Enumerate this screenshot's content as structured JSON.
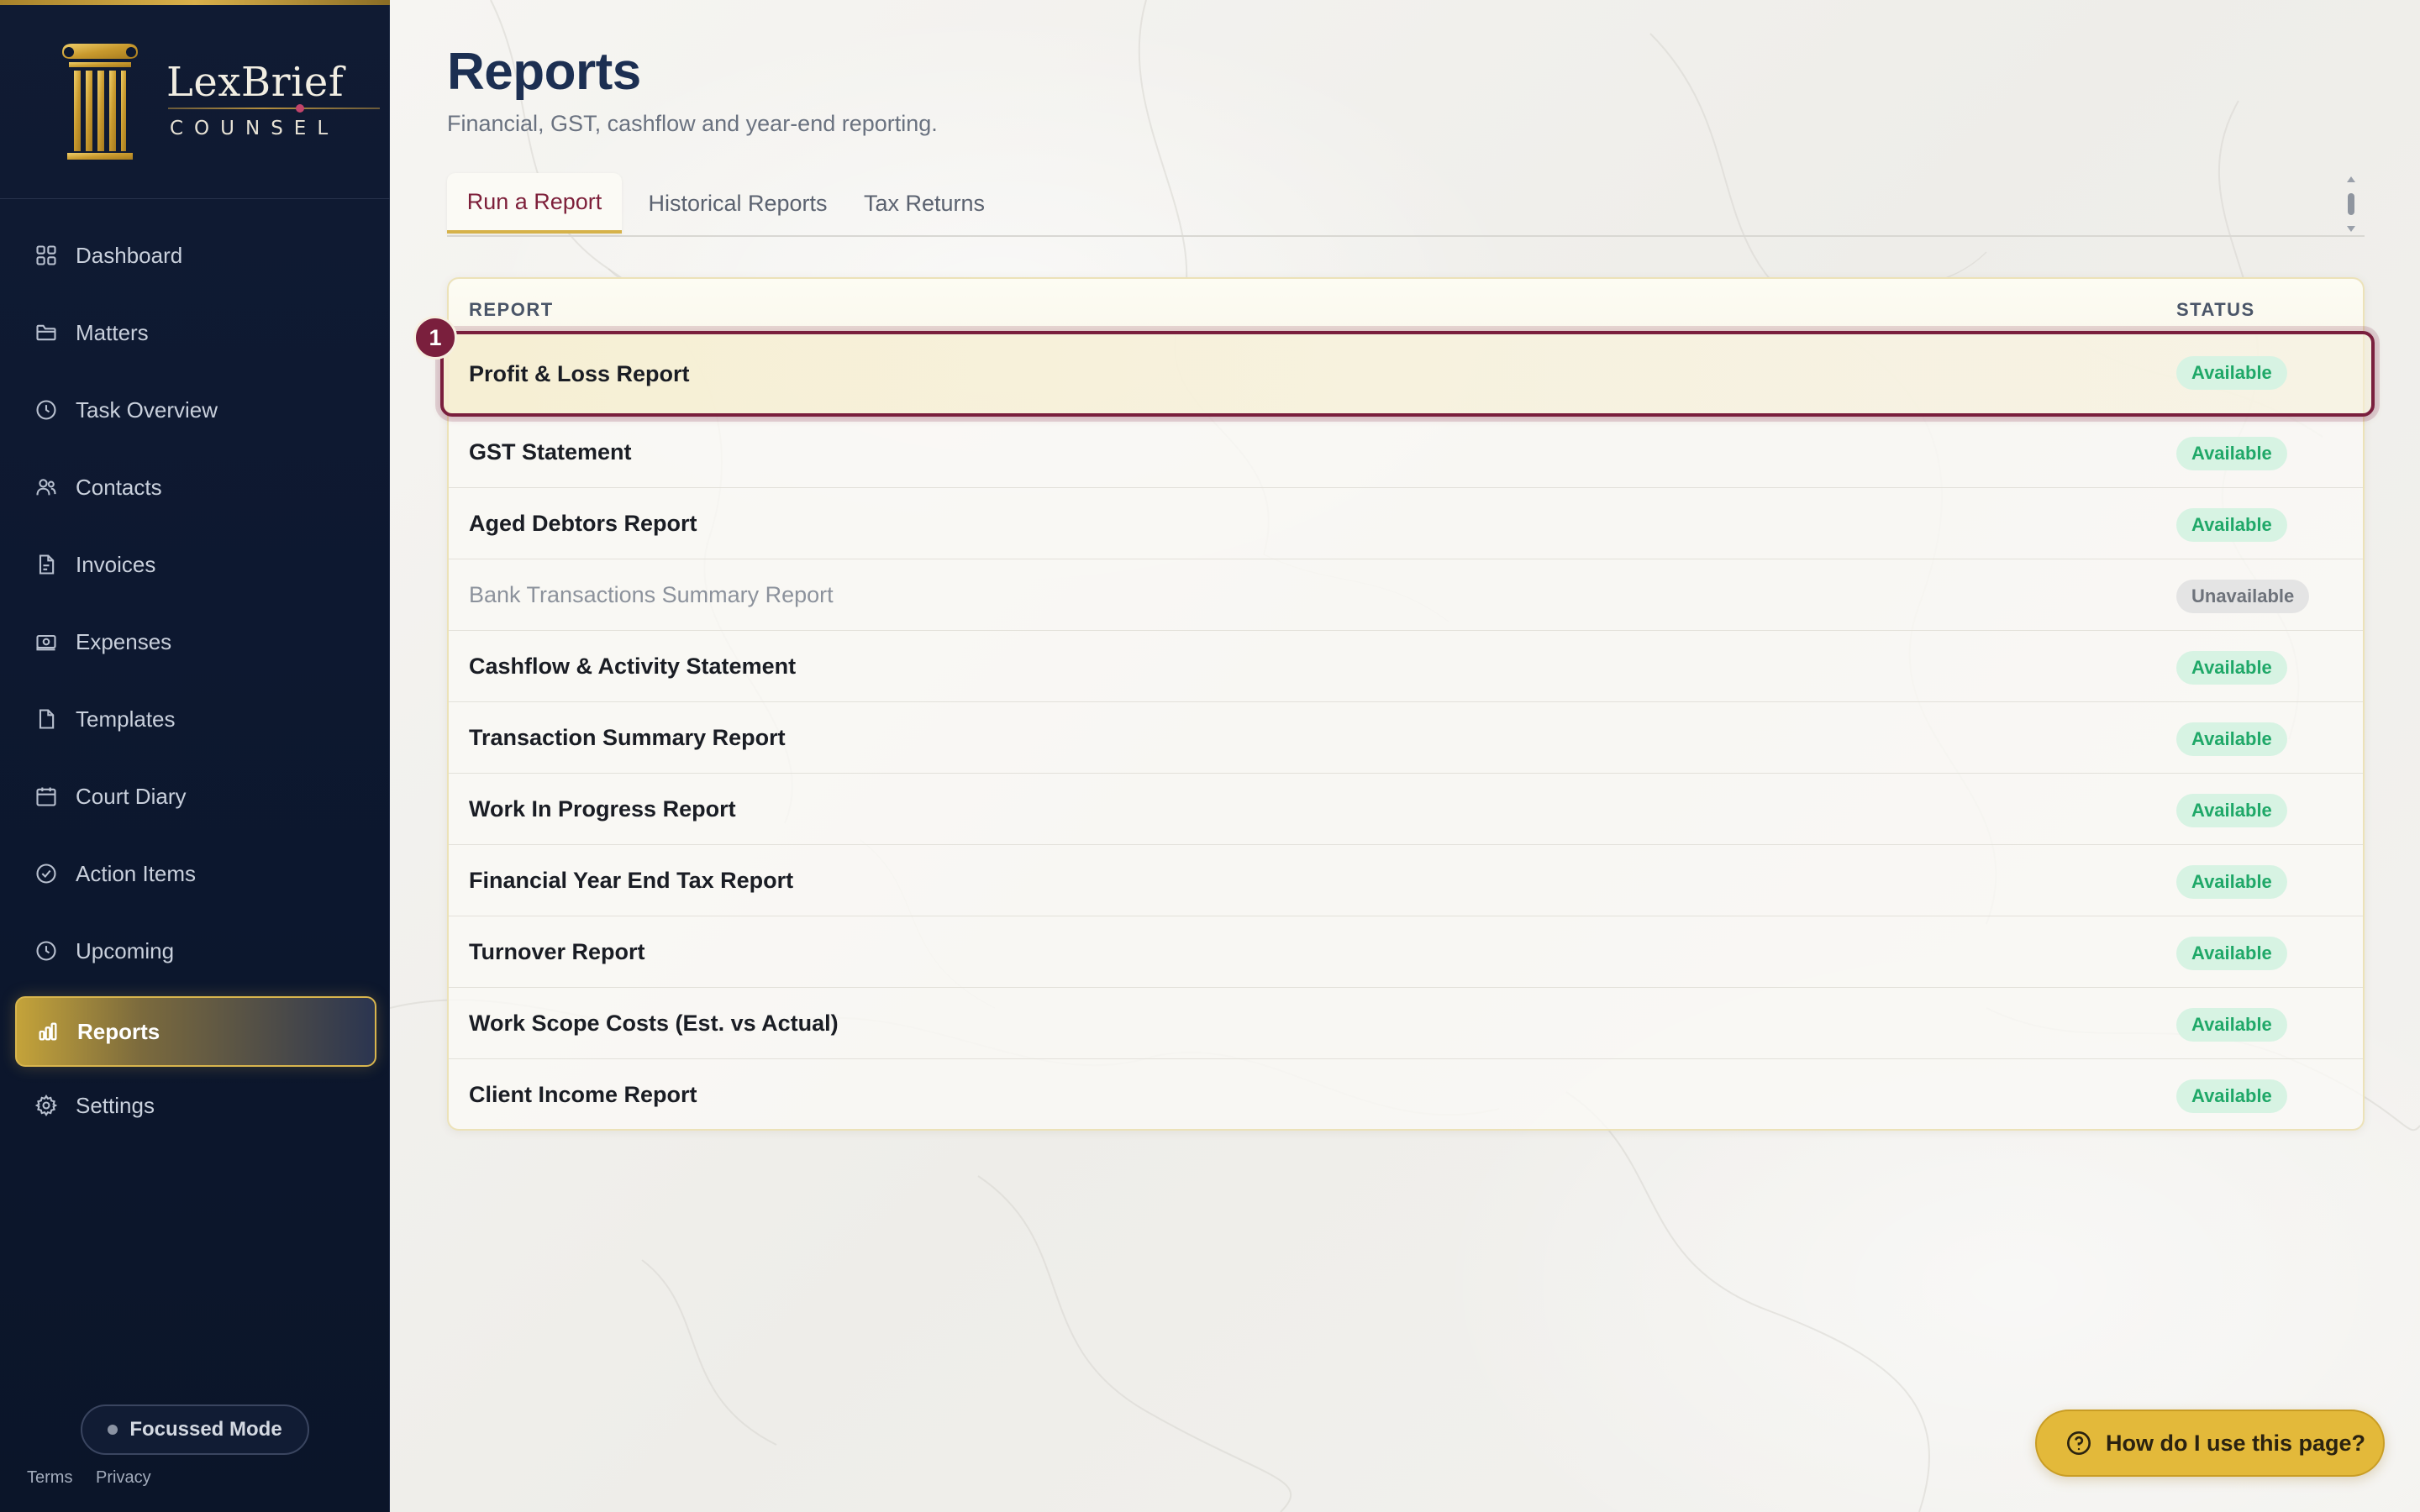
{
  "brand": {
    "name": "LexBrief",
    "tagline": "COUNSEL"
  },
  "sidebar": {
    "items": [
      {
        "label": "Dashboard",
        "icon": "dashboard-grid-icon"
      },
      {
        "label": "Matters",
        "icon": "folder-icon"
      },
      {
        "label": "Task Overview",
        "icon": "clock-icon"
      },
      {
        "label": "Contacts",
        "icon": "users-icon"
      },
      {
        "label": "Invoices",
        "icon": "invoice-file-icon"
      },
      {
        "label": "Expenses",
        "icon": "banknote-icon"
      },
      {
        "label": "Templates",
        "icon": "document-icon"
      },
      {
        "label": "Court Diary",
        "icon": "calendar-icon"
      },
      {
        "label": "Action Items",
        "icon": "check-circle-icon"
      },
      {
        "label": "Upcoming",
        "icon": "clock-icon"
      },
      {
        "label": "Reports",
        "icon": "bar-chart-icon",
        "active": true
      },
      {
        "label": "Settings",
        "icon": "gear-icon"
      }
    ],
    "focus_mode": "Focussed Mode",
    "terms": "Terms",
    "privacy": "Privacy"
  },
  "header": {
    "title": "Reports",
    "subtitle": "Financial, GST, cashflow and year-end reporting."
  },
  "tabs": [
    {
      "label": "Run a Report",
      "active": true
    },
    {
      "label": "Historical Reports"
    },
    {
      "label": "Tax Returns"
    }
  ],
  "table": {
    "columns": {
      "report": "REPORT",
      "status": "STATUS"
    },
    "step_marker": "1",
    "rows": [
      {
        "name": "Profit & Loss Report",
        "status": "Available"
      },
      {
        "name": "GST Statement",
        "status": "Available"
      },
      {
        "name": "Aged Debtors Report",
        "status": "Available"
      },
      {
        "name": "Bank Transactions Summary Report",
        "status": "Unavailable"
      },
      {
        "name": "Cashflow & Activity Statement",
        "status": "Available"
      },
      {
        "name": "Transaction Summary Report",
        "status": "Available"
      },
      {
        "name": "Work In Progress Report",
        "status": "Available"
      },
      {
        "name": "Financial Year End Tax Report",
        "status": "Available"
      },
      {
        "name": "Turnover Report",
        "status": "Available"
      },
      {
        "name": "Work Scope Costs (Est. vs Actual)",
        "status": "Available"
      },
      {
        "name": "Client Income Report",
        "status": "Available"
      }
    ]
  },
  "help": {
    "label": "How do I use this page?"
  },
  "colors": {
    "sidebar_bg": "#0d1830",
    "accent_gold": "#d6b24a",
    "accent_maroon": "#7a1f3d",
    "title_navy": "#1c2f52",
    "available_green": "#1fa868",
    "available_bg": "#d7f3e3",
    "unavailable_bg": "#e4e4e4"
  }
}
